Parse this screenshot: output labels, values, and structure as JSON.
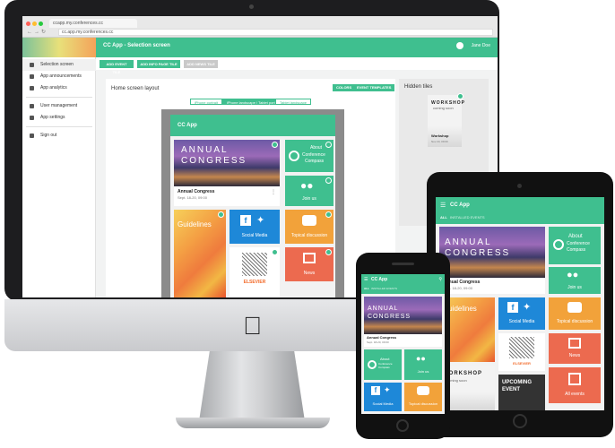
{
  "browser": {
    "tab_title": "ccapp.my.conferences.cc",
    "url": "cc.app.my.conferences.cc"
  },
  "desktop": {
    "title": "CC App - Selection screen",
    "user": "Jane Doe",
    "sidebar": {
      "items": [
        {
          "label": "Selection screen"
        },
        {
          "label": "App announcements"
        },
        {
          "label": "App analytics"
        },
        {
          "label": "User management"
        },
        {
          "label": "App settings"
        },
        {
          "label": "Sign out"
        }
      ]
    },
    "toolbar": {
      "add_event": "ADD EVENT TILE",
      "add_info": "ADD INFO PAGE TILE",
      "add_news": "ADD NEWS TILE"
    },
    "layout": {
      "title": "Home screen layout",
      "colors": "COLORS",
      "templates": "EVENT TEMPLATES",
      "segments": [
        "iPhone portrait",
        "iPhone landscape / Tablet portrait",
        "Tablet landscape"
      ]
    },
    "hidden": {
      "title": "Hidden tiles",
      "tile_banner": "WORKSHOP",
      "tile_sub": "coming soon",
      "tile_label": "Workshop",
      "tile_date": "Nov 23, 09:00"
    },
    "app": {
      "name": "CC App",
      "annual": "ANNUAL",
      "congress": "CONGRESS",
      "event_label": "Annual Congress",
      "event_date": "Sept. 18-20, 09:00",
      "about_line1": "About",
      "about_line2": "Conference",
      "about_line3": "Compass",
      "join": "Join us",
      "guidelines": "Guidelines",
      "social": "Social Media",
      "topical": "Topical discussion",
      "elsevier": "ELSEVIER",
      "news": "News"
    }
  },
  "tablet": {
    "app_name": "CC App",
    "tabs": [
      "ALL",
      "INSTALLED EVENTS"
    ],
    "annual": "ANNUAL",
    "congress": "CONGRESS",
    "event_label": "Annual Congress",
    "event_date": "Sept. 18-20, 09:00",
    "about": "About",
    "about_sub1": "Conference",
    "about_sub2": "Compass",
    "join": "Join us",
    "guidelines": "Guidelines",
    "social": "Social Media",
    "topical": "Topical discussion",
    "news": "News",
    "workshop": "WORKSHOP",
    "workshop_sub": "coming soon",
    "upcoming": "UPCOMING",
    "upcoming2": "EVENT",
    "all_events": "All events",
    "elsevier": "ELSEVIER"
  },
  "phone": {
    "app_name": "CC App",
    "tabs": [
      "ALL",
      "INSTALLED EVENTS"
    ],
    "annual": "ANNUAL",
    "congress": "CONGRESS",
    "event_label": "Annual Congress",
    "event_date": "Sept. 18-20, 09:00",
    "about": "About",
    "about_sub": "Conference Compass",
    "join": "Join us",
    "social": "Social Media",
    "topical": "Topical discussion"
  },
  "colors": {
    "accent": "#3fbf8f",
    "blue": "#1e88d8",
    "orange": "#f2a23a",
    "red": "#ec6a4f"
  }
}
